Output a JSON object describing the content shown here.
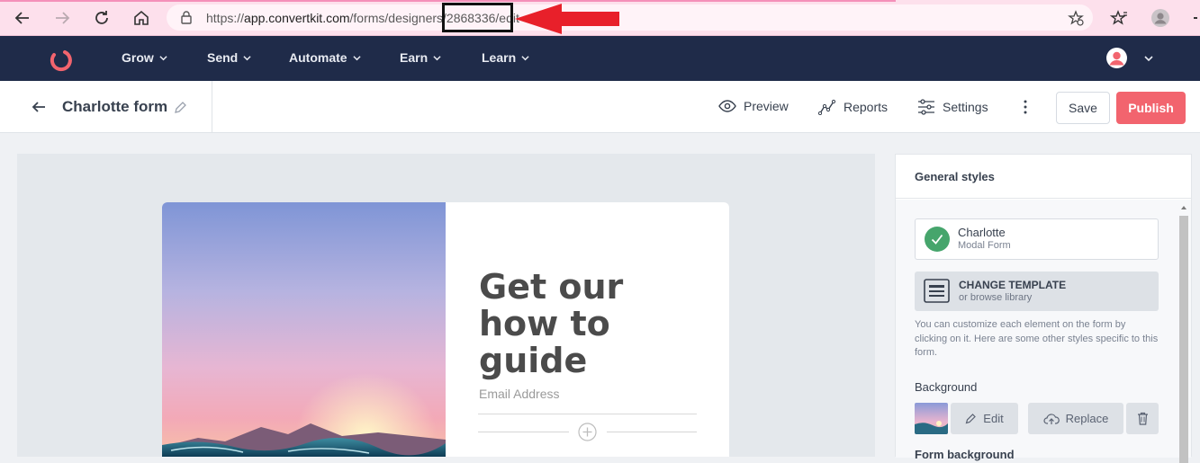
{
  "browser": {
    "url_prefix": "https://",
    "url_host": "app.convertkit.com",
    "url_path": "/forms/designers/2868336/edit",
    "highlighted_segment": "2868336",
    "annotation_color": "#e8202a"
  },
  "app_nav": {
    "items": [
      {
        "label": "Grow"
      },
      {
        "label": "Send"
      },
      {
        "label": "Automate"
      },
      {
        "label": "Earn"
      },
      {
        "label": "Learn"
      }
    ],
    "brand_color": "#f2646e",
    "bg_color": "#1f2b49"
  },
  "editor": {
    "form_title": "Charlotte form",
    "actions": {
      "preview": "Preview",
      "reports": "Reports",
      "settings": "Settings",
      "save": "Save",
      "publish": "Publish"
    }
  },
  "form_preview": {
    "headline": "Get our how to guide",
    "email_placeholder": "Email Address"
  },
  "sidebar": {
    "title": "General styles",
    "template": {
      "name": "Charlotte",
      "type": "Modal Form"
    },
    "change_template": {
      "label": "CHANGE TEMPLATE",
      "sub": "or browse library"
    },
    "helper_text": "You can customize each element on the form by clicking on it. Here are some other styles specific to this form.",
    "background_label": "Background",
    "edit_label": "Edit",
    "replace_label": "Replace",
    "form_background_label": "Form background"
  }
}
